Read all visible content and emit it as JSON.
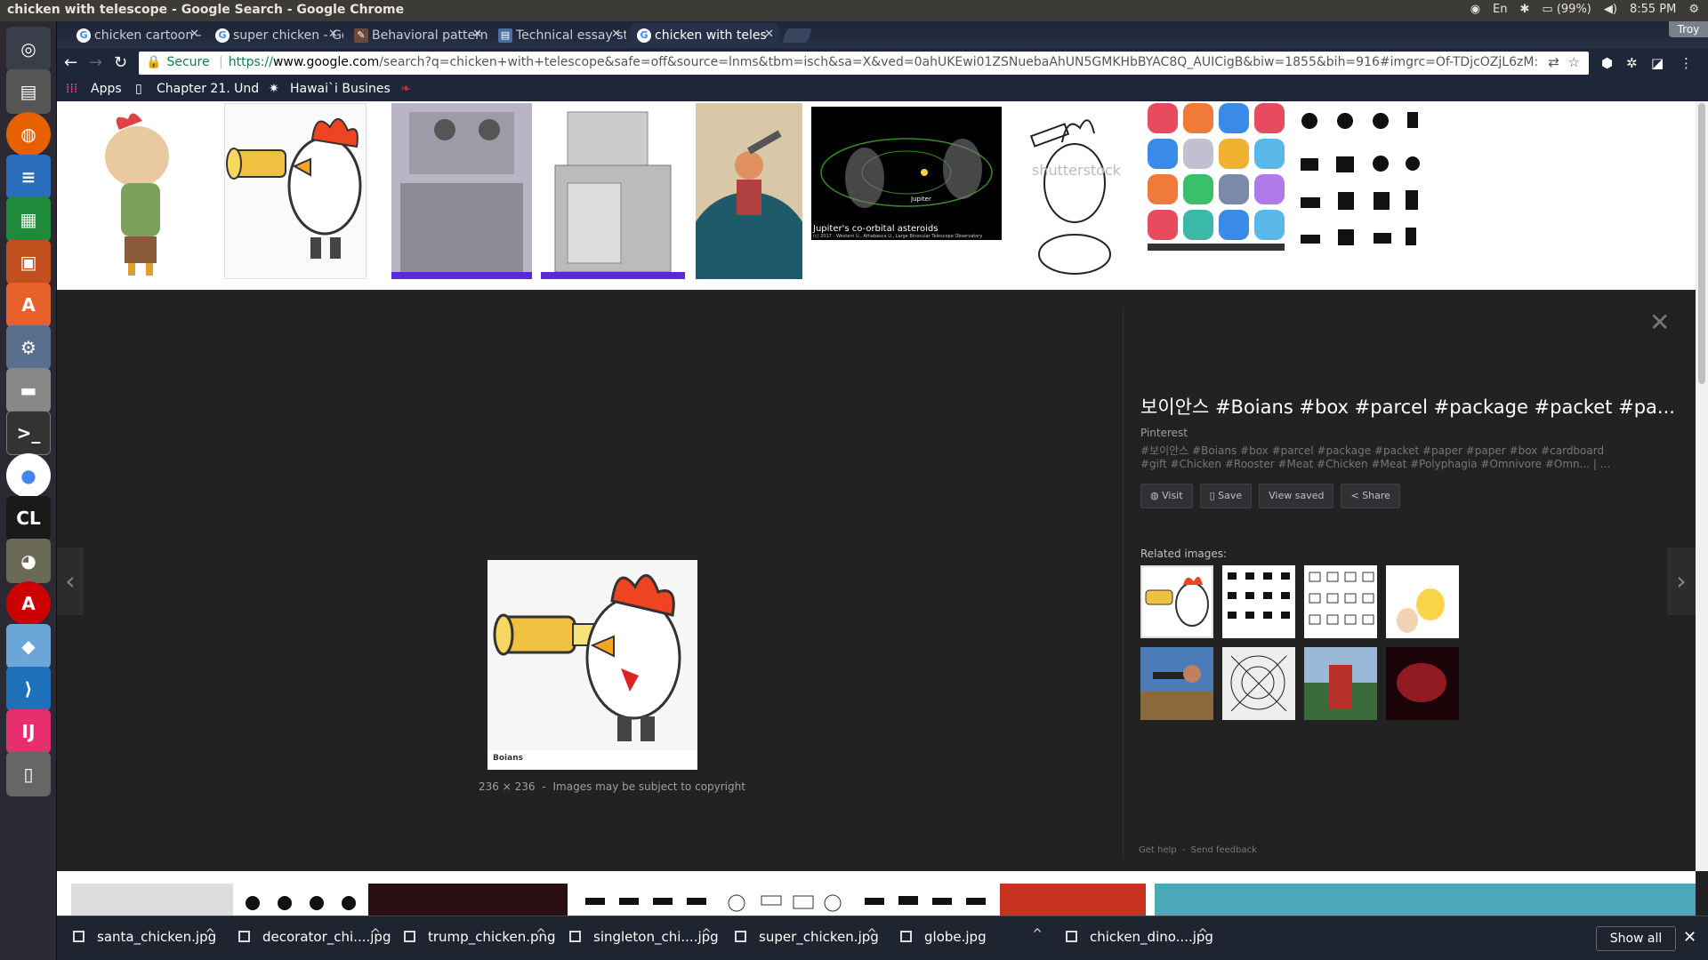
{
  "window": {
    "title": "chicken with telescope - Google Search - Google Chrome"
  },
  "tray": {
    "battery": "(99%)",
    "time": "8:55 PM"
  },
  "tabs": [
    {
      "label": "chicken cartoon - Go",
      "active": false
    },
    {
      "label": "super chicken - Goo",
      "active": false
    },
    {
      "label": "Behavioral patterns",
      "active": false
    },
    {
      "label": "Technical essay sty",
      "active": false
    },
    {
      "label": "chicken with teles",
      "active": true
    }
  ],
  "profile": "Troy",
  "omnibox": {
    "secure": "Secure",
    "url_scheme": "https://",
    "url_domain": "www.google.com",
    "url_rest": "/search?q=chicken+with+telescope&safe=off&source=lnms&tbm=isch&sa=X&ved=0ahUKEwi01ZSNuebaAhUN5GMKHbBYAC8Q_AUICigB&biw=1855&bih=916#imgrc=Of-TDjcOZjL6zM:"
  },
  "bookmarks": {
    "apps": "Apps",
    "item1": "Chapter 21. Und",
    "item2": "Hawai`i Busines"
  },
  "thumbnails": {
    "t6_caption": "Jupiter's co-orbital asteroids",
    "t6_credit": "(c) 2017 - Western U., Athabasca U., Large Binocular Telescope Observatory",
    "t6_label": "Jupiter",
    "watermark": "shutterstock"
  },
  "preview": {
    "title": "보이안스 #Boians #box #parcel #package #packet #pa...",
    "source": "Pinterest",
    "description": "#보이안스 #Boians #box #parcel #package #packet #paper #paper #box #cardboard #gift #Chicken #Rooster #Meat #Chicken #Meat #Polyphagia #Omnivore #Omn... | ...",
    "actions": {
      "visit": "Visit",
      "save": "Save",
      "view_saved": "View saved",
      "share": "Share"
    },
    "related_label": "Related images:",
    "size": "236 × 236",
    "copyright": "Images may be subject to copyright",
    "get_help": "Get help",
    "send_feedback": "Send feedback",
    "main_img_brand": "Boians"
  },
  "downloads": [
    {
      "name": "santa_chicken.jpg"
    },
    {
      "name": "decorator_chi....jpg"
    },
    {
      "name": "trump_chicken.png"
    },
    {
      "name": "singleton_chi....jpg"
    },
    {
      "name": "super_chicken.jpg"
    },
    {
      "name": "globe.jpg"
    },
    {
      "name": "chicken_dino....jpg"
    }
  ],
  "shelf": {
    "show_all": "Show all"
  }
}
